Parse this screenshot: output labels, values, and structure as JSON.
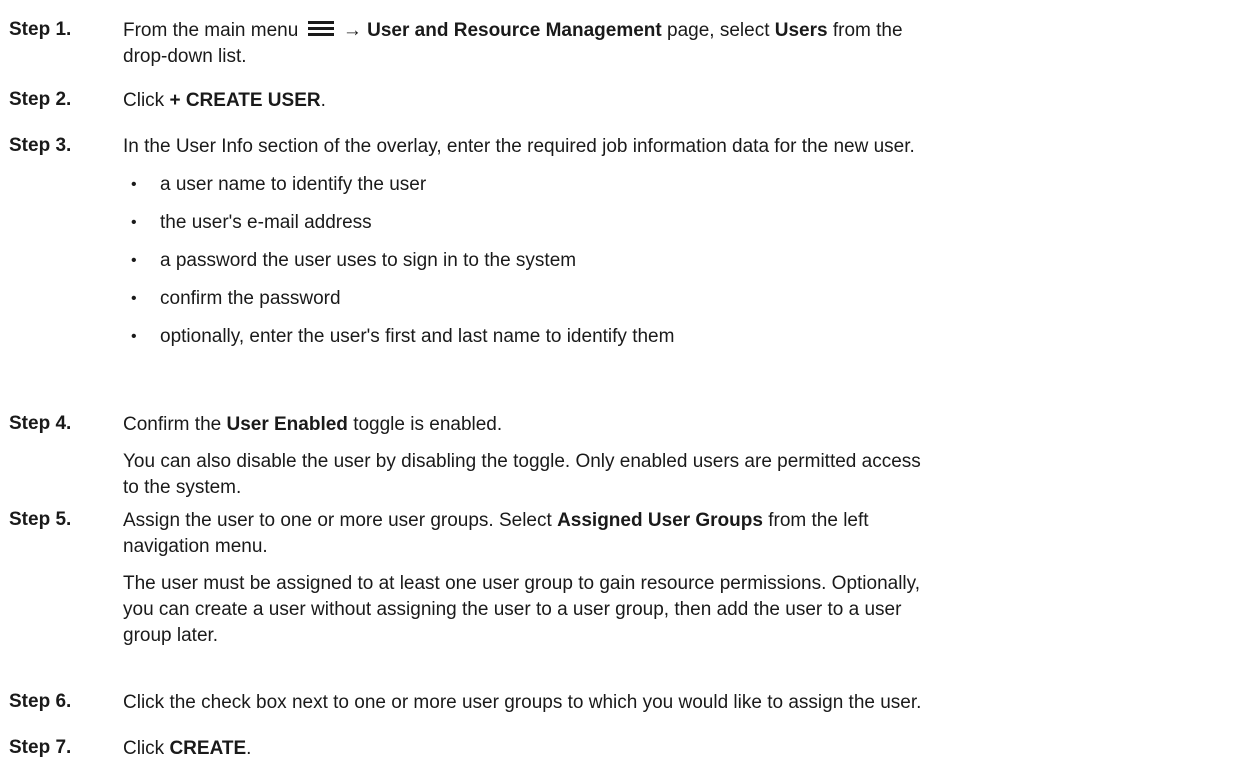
{
  "steps": [
    {
      "label": "Step 1.",
      "t1": "From the main menu ",
      "arrow": " → ",
      "b1": "User and Resource Management",
      "t2": " page, select ",
      "b2": "Users",
      "t3": " from the",
      "line2": "drop-down list."
    },
    {
      "label": "Step 2.",
      "t1": "Click ",
      "b1": "+ CREATE USER",
      "t2": "."
    },
    {
      "label": "Step 3.",
      "t1": "In the User Info section of the overlay, enter the required job information data for the new user.",
      "bullets": [
        "a user name to identify the user",
        "the user's e-mail address",
        "a password the user uses to sign in to the system",
        "confirm the password",
        "optionally, enter the user's first and last name to identify them"
      ]
    },
    {
      "label": "Step 4.",
      "t1": "Confirm the ",
      "b1": "User Enabled",
      "t2": " toggle is enabled.",
      "sub1": "You can also disable the user by disabling the toggle. Only enabled users are permitted access",
      "sub2": "to the system."
    },
    {
      "label": "Step 5.",
      "t1": "Assign the user to one or more user groups. Select ",
      "b1": "Assigned User Groups",
      "t2": " from the left",
      "line2": "navigation menu.",
      "sub1": "The user must be assigned to at least one user group to gain resource permissions. Optionally,",
      "sub2": "you can create a user without assigning the user to a user group, then add the user to a user",
      "sub3": "group later."
    },
    {
      "label": "Step 6.",
      "t1": "Click the check box next to one or more user groups to which you would like to assign the user."
    },
    {
      "label": "Step 7.",
      "t1": "Click ",
      "b1": "CREATE",
      "t2": "."
    }
  ],
  "icons": {
    "menu": "hamburger-menu-icon"
  }
}
